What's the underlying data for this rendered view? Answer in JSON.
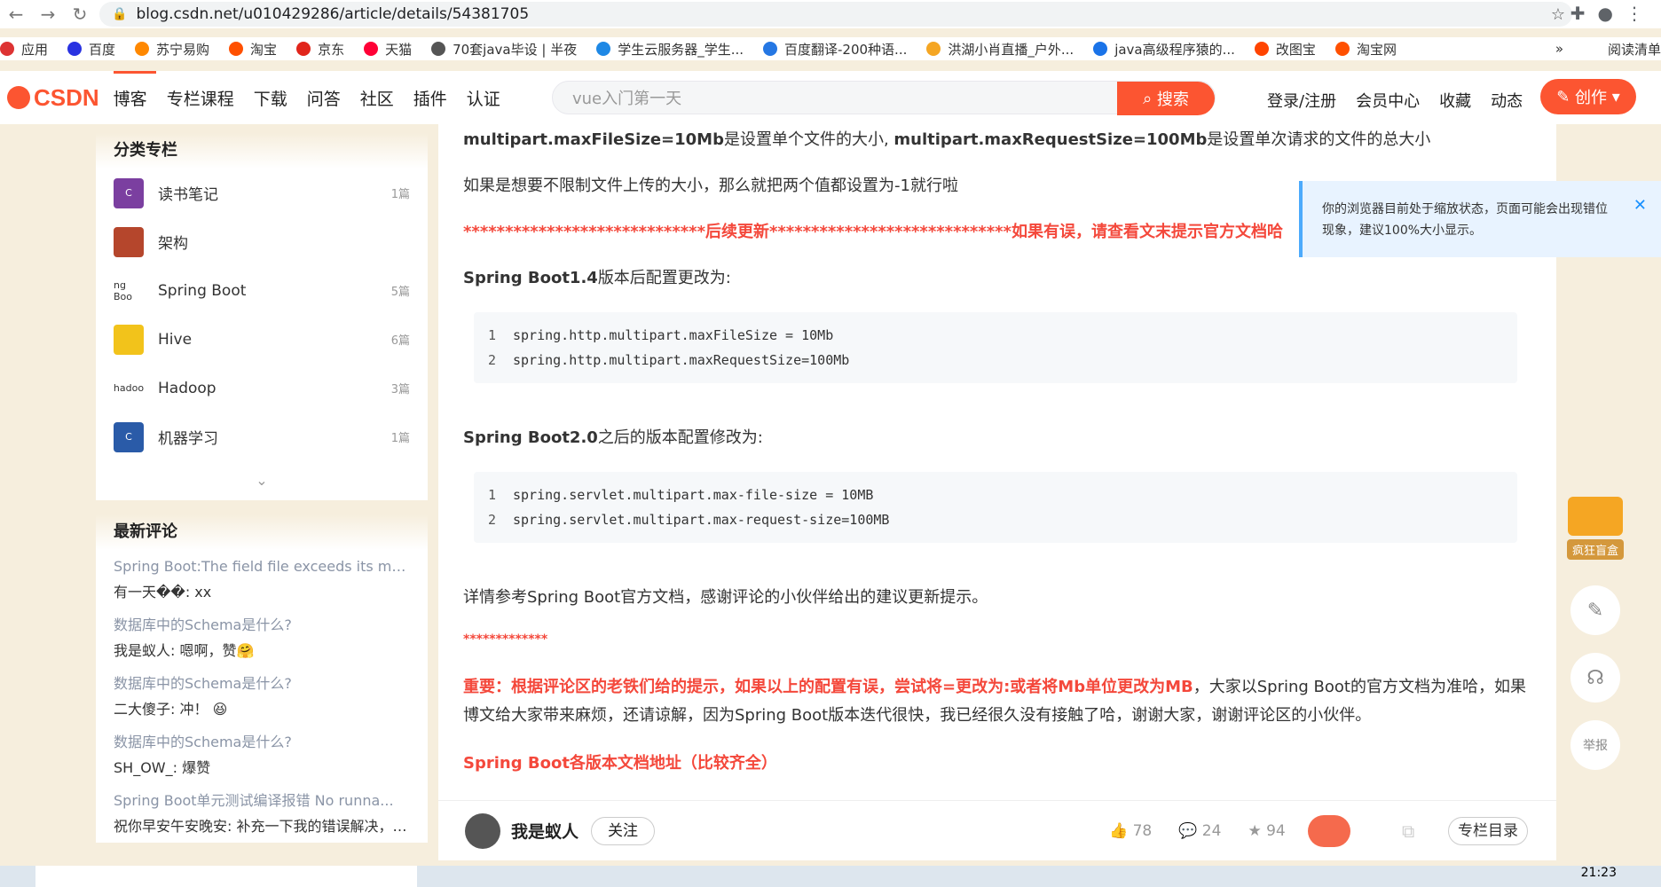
{
  "browser": {
    "url": "blog.csdn.net/u010429286/article/details/54381705",
    "bookmarks": [
      "应用",
      "百度",
      "苏宁易购",
      "淘宝",
      "京东",
      "天猫",
      "70套java毕设 | 半夜",
      "学生云服务器_学生...",
      "百度翻译-200种语...",
      "洪湖小肖直播_户外...",
      "java高级程序猿的...",
      "改图宝",
      "淘宝网"
    ],
    "bookmark_overflow": "»",
    "reading_list": "阅读清单"
  },
  "header": {
    "logo": "CSDN",
    "nav": [
      "博客",
      "专栏课程",
      "下载",
      "问答",
      "社区",
      "插件",
      "认证"
    ],
    "search_placeholder": "vue入门第一天",
    "search_btn": "搜索",
    "right_links": [
      "登录/注册",
      "会员中心",
      "收藏",
      "动态"
    ],
    "create_btn": "创作"
  },
  "sidebar": {
    "columns_title": "分类专栏",
    "columns": [
      {
        "name": "读书笔记",
        "count": "1篇",
        "thumb": "C",
        "color": "#7b3fa0"
      },
      {
        "name": "架构",
        "count": "",
        "thumb": "",
        "color": "#b5462c"
      },
      {
        "name": "Spring Boot",
        "count": "5篇",
        "thumb": "ng Boo",
        "color": "#ffffff"
      },
      {
        "name": "Hive",
        "count": "6篇",
        "thumb": "",
        "color": "#f2c31b"
      },
      {
        "name": "Hadoop",
        "count": "3篇",
        "thumb": "hadoo",
        "color": "#ffffff"
      },
      {
        "name": "机器学习",
        "count": "1篇",
        "thumb": "C",
        "color": "#2a5ba8"
      }
    ],
    "comments_title": "最新评论",
    "comments": [
      {
        "title": "Spring Boot:The field file exceeds its ma...",
        "text": "有一天��: xx"
      },
      {
        "title": "数据库中的Schema是什么?",
        "text": "我是蚁人: 嗯啊，赞🤗"
      },
      {
        "title": "数据库中的Schema是什么?",
        "text": "二大傻子: 冲！ 😆"
      },
      {
        "title": "数据库中的Schema是什么?",
        "text": "SH_OW_: 爆赞"
      },
      {
        "title": "Spring Boot单元测试编译报错 No runna...",
        "text": "祝你早安午安晚安: 补充一下我的错误解决，添加了@Test注解，但是引用的包不..."
      }
    ]
  },
  "article": {
    "p1_a": "multipart.maxFileSize=10Mb",
    "p1_b": "是设置单个文件的大小, ",
    "p1_c": "multipart.maxRequestSize=100Mb",
    "p1_d": "是设置单次请求的文件的总大小",
    "p2": "如果是想要不限制文件上传的大小，那么就把两个值都设置为-1就行啦",
    "p3_stars1": "*****************************",
    "p3_a": "后续更新",
    "p3_stars2": "*****************************",
    "p3_b": "如果有误，请查看文末提示官方文档哈",
    "h14_a": "Spring Boot1.4",
    "h14_b": "版本后配置更改为:",
    "code1": [
      "spring.http.multipart.maxFileSize = 10Mb",
      "spring.http.multipart.maxRequestSize=100Mb"
    ],
    "h20_a": "Spring Boot2.0",
    "h20_b": "之后的版本配置修改为:",
    "code2": [
      "spring.servlet.multipart.max-file-size = 10MB",
      "spring.servlet.multipart.max-request-size=100MB"
    ],
    "p4": "详情参考Spring Boot官方文档，感谢评论的小伙伴给出的建议更新提示。",
    "p5_stars": "*************",
    "p6_red": "重要：根据评论区的老铁们给的提示，如果以上的配置有误，尝试将=更改为:或者将Mb单位更改为MB",
    "p6_rest": "，大家以Spring Boot的官方文档为准哈，如果博文给大家带来麻烦，还请谅解，因为Spring Boot版本迭代很快，我已经很久没有接触了哈，谢谢大家，谢谢评论区的小伙伴。",
    "p7": "Spring Boot各版本文档地址（比较齐全）"
  },
  "notice": {
    "text": "你的浏览器目前处于缩放状态，页面可能会出现错位现象，建议100%大小显示。"
  },
  "float_tools": {
    "box_label": "疯狂盲盒",
    "report": "举报"
  },
  "footer": {
    "author": "我是蚁人",
    "follow": "关注",
    "likes": "78",
    "comments": "24",
    "favorites": "94",
    "toc": "专栏目录"
  },
  "taskbar": {
    "clock": "21:23"
  }
}
